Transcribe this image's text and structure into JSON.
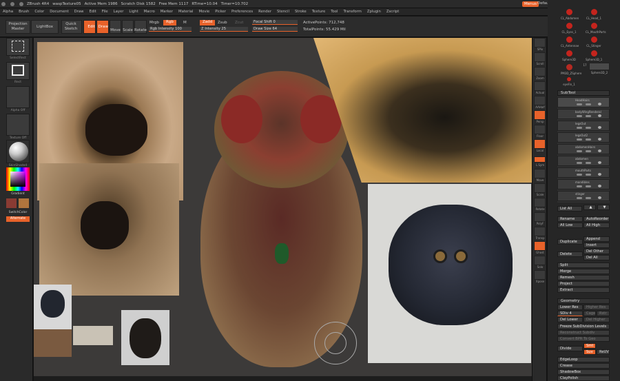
{
  "titlebar": {
    "app": "ZBrush 4R4",
    "doc": "waspTexture05",
    "active_mem": "Active Mem 1986",
    "scratch": "Scratch Disk 1582",
    "free_mem": "Free Mem 1117",
    "rtime": "RTime=10.04",
    "timer": "Timer=10.702",
    "menus_btn": "Menus",
    "script": "DefaultZScript"
  },
  "menubar": [
    "Alpha",
    "Brush",
    "Color",
    "Document",
    "Draw",
    "Edit",
    "File",
    "Layer",
    "Light",
    "Macro",
    "Marker",
    "Material",
    "Movie",
    "Picker",
    "Preferences",
    "Render",
    "Stencil",
    "Stroke",
    "Texture",
    "Tool",
    "Transform",
    "Zplugin",
    "Zscript"
  ],
  "toolbar": {
    "projection_master": "Projection Master",
    "lightbox": "LightBox",
    "quick_sketch": "Quick Sketch",
    "edit": "Edit",
    "draw": "Draw",
    "move": "Move",
    "scale": "Scale",
    "rotate": "Rotate",
    "mrgb": "Mrgb",
    "rgb": "Rgb",
    "m": "M",
    "rgb_intensity": "Rgb Intensity 100",
    "zadd": "Zadd",
    "zsub": "Zsub",
    "zcut": "Zcut",
    "z_intensity": "Z Intensity 25",
    "focal_shift": "Focal Shift 0",
    "draw_size": "Draw Size 64",
    "active_points": "ActivePoints: 712,748",
    "total_points": "TotalPoints: 55.429 Mil"
  },
  "leftshelf": {
    "selectrect": "SelectRect",
    "rect": "Rect",
    "alpha_off": "Alpha Off",
    "texture_off": "Texture Off",
    "material": "SkinShade4",
    "gradient": "Gradient",
    "switch_color": "SwitchColor",
    "alternate": "Alternate"
  },
  "rightshelf": [
    "SPix",
    "Scroll",
    "Zoom",
    "Actual",
    "AAHalf",
    "Persp",
    "Floor",
    "Local",
    "L.Sym",
    "Move",
    "Scale",
    "Rotate",
    "PolyF",
    "Transp",
    "Ghost",
    "Solo",
    "Xpose"
  ],
  "tray": {
    "tools": [
      "CL_Abdomen",
      "CL_Head_1",
      "CL_Eyes_1",
      "CL_MouthParts",
      "CL_Antennae",
      "CL_Stinger",
      "Sphere3D",
      "Sphere3D_1",
      "PM3D_ZSphere",
      "Sphere3D_2",
      "eyeFin_1"
    ],
    "thumb_count": "17",
    "subtool_head": "SubTool",
    "subtools": [
      "HeadHairs",
      "bodyWingRenderal",
      "legsOut",
      "legsOut2",
      "abdomenHairs",
      "abdomen",
      "mouthParts",
      "mandibles",
      "stinger"
    ],
    "list_all": "List All",
    "rename": "Rename",
    "autoreorder": "AutoReorder",
    "all_low": "All Low",
    "all_high": "All High",
    "duplicate": "Duplicate",
    "append": "Append",
    "insert": "Insert",
    "delete": "Delete",
    "del_other": "Del Other",
    "del_all": "Del All",
    "split": "Split",
    "merge": "Merge",
    "remesh": "Remesh",
    "project": "Project",
    "extract": "Extract",
    "geometry_head": "Geometry",
    "lower_res": "Lower Res",
    "higher_res": "Higher Res",
    "sdiv": "SDiv 4",
    "cage": "Cage",
    "rstr": "Rstr",
    "del_lower": "Del Lower",
    "del_higher": "Del Higher",
    "freeze": "Freeze SubDivision Levels",
    "reconstruct": "Reconstruct Subdiv",
    "convert": "Convert BPR To Geo",
    "divide": "Divide",
    "smt": "Smt",
    "suv": "Suv",
    "reuv": "ReUV",
    "edgeloop": "EdgeLoop",
    "crease": "Crease",
    "shadowbox": "ShadowBox",
    "claypolish": "ClayPolish"
  },
  "colors": {
    "accent": "#e8622a",
    "panel": "#2a2a2a",
    "canvas": "#3c3a39"
  }
}
